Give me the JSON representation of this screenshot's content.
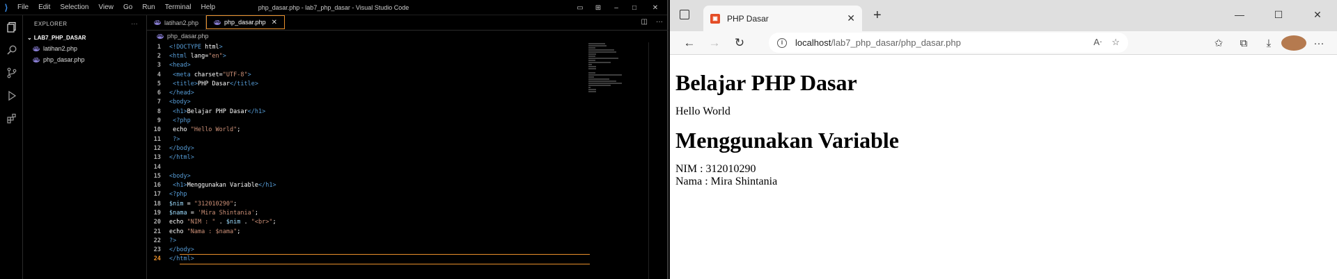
{
  "vscode": {
    "menu": [
      "File",
      "Edit",
      "Selection",
      "View",
      "Go",
      "Run",
      "Terminal",
      "Help"
    ],
    "window_title": "php_dasar.php - lab7_php_dasar - Visual Studio Code",
    "explorer_label": "EXPLORER",
    "folder": "LAB7_PHP_DASAR",
    "files": [
      "latihan2.php",
      "php_dasar.php"
    ],
    "tabs": [
      {
        "label": "latihan2.php"
      },
      {
        "label": "php_dasar.php"
      }
    ],
    "breadcrumb": "php_dasar.php",
    "current_line": 24,
    "code_lines": [
      "<!DOCTYPE html>",
      "<html lang=\"en\">",
      "<head>",
      " <meta charset=\"UTF-8\">",
      " <title>PHP Dasar</title>",
      "</head>",
      "<body>",
      " <h1>Belajar PHP Dasar</h1>",
      " <?php",
      " echo \"Hello World\";",
      " ?>",
      "</body>",
      "</html>",
      "",
      "<body>",
      " <h1>Menggunakan Variable</h1>",
      "<?php",
      "$nim = \"312010290\";",
      "$nama = 'Mira Shintania';",
      "echo \"NIM : \" . $nim . \"<br>\";",
      "echo \"Nama : $nama\";",
      "?>",
      "</body>",
      "</html>"
    ]
  },
  "browser": {
    "tab_title": "PHP Dasar",
    "url_host": "localhost",
    "url_path": "/lab7_php_dasar/php_dasar.php",
    "page": {
      "heading1": "Belajar PHP Dasar",
      "hello": "Hello World",
      "heading2": "Menggunakan Variable",
      "nim_line": "NIM : 312010290",
      "nama_line": "Nama : Mira Shintania"
    }
  }
}
